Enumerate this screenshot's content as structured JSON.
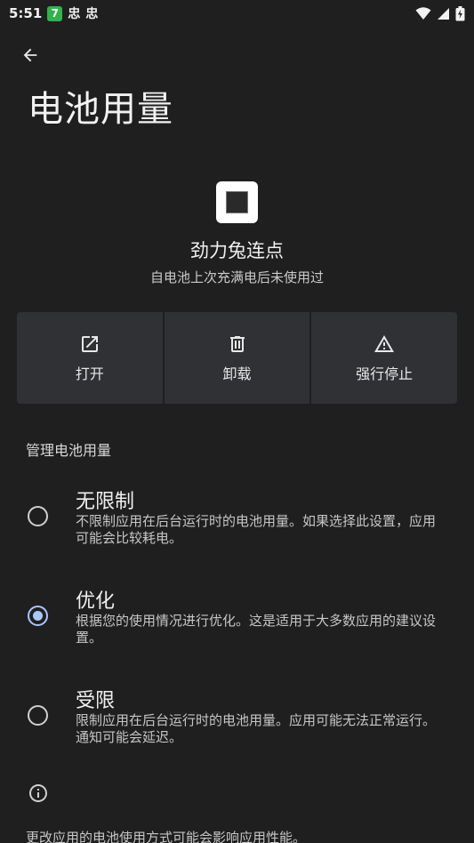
{
  "status_bar": {
    "time": "5:51",
    "notif_badge": "7",
    "notif_1": "忠",
    "notif_2": "忠"
  },
  "header": {
    "title": "电池用量"
  },
  "app": {
    "name": "劲力兔连点",
    "subtitle": "自电池上次充满电后未使用过"
  },
  "actions": {
    "open_label": "打开",
    "uninstall_label": "卸载",
    "force_stop_label": "强行停止"
  },
  "section": {
    "label": "管理电池用量"
  },
  "options": [
    {
      "title": "无限制",
      "desc": "不限制应用在后台运行时的电池用量。如果选择此设置，应用可能会比较耗电。",
      "selected": false
    },
    {
      "title": "优化",
      "desc": "根据您的使用情况进行优化。这是适用于大多数应用的建议设置。",
      "selected": true
    },
    {
      "title": "受限",
      "desc": "限制应用在后台运行时的电池用量。应用可能无法正常运行。通知可能会延迟。",
      "selected": false
    }
  ],
  "footer": {
    "text": "更改应用的电池使用方式可能会影响应用性能。"
  },
  "colors": {
    "background": "#1f1f1f",
    "button_bg": "#303134",
    "accent": "#a8c7fa"
  }
}
